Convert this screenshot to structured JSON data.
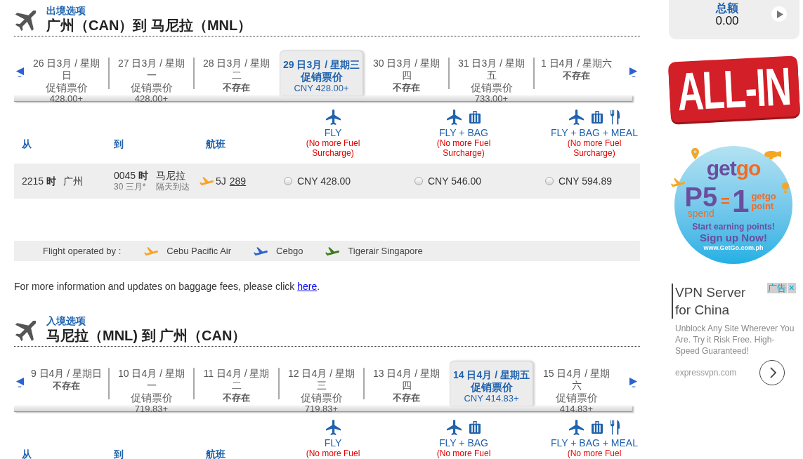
{
  "outbound": {
    "label": "出境选项",
    "route": "广州（CAN）到 马尼拉（MNL）",
    "dates": [
      {
        "date": "26 日3月 / 星期日",
        "kind": "fare",
        "fare": "促销票价",
        "price": "428.00+",
        "selected": false
      },
      {
        "date": "27 日3月 / 星期一",
        "kind": "fare",
        "fare": "促销票价",
        "price": "428.00+",
        "selected": false
      },
      {
        "date": "28 日3月 / 星期二",
        "kind": "unavailable",
        "fare": "不存在",
        "selected": false
      },
      {
        "date": "29 日3月 / 星期三",
        "kind": "fare",
        "fare": "促销票价",
        "price": "CNY 428.00+",
        "selected": true
      },
      {
        "date": "30 日3月 / 星期四",
        "kind": "unavailable",
        "fare": "不存在",
        "selected": false
      },
      {
        "date": "31 日3月 / 星期五",
        "kind": "fare",
        "fare": "促销票价",
        "price": "733.00+",
        "selected": false
      },
      {
        "date": "1 日4月 / 星期六",
        "kind": "unavailable",
        "fare": "不存在",
        "selected": false
      }
    ],
    "columns": [
      "从",
      "到",
      "航班"
    ],
    "fare_types": [
      {
        "kind": "fly",
        "name": "FLY",
        "note": "(No more Fuel Surcharge)"
      },
      {
        "kind": "fly_bag",
        "name": "FLY + BAG",
        "note": "(No more Fuel Surcharge)"
      },
      {
        "kind": "fly_bag_meal",
        "name": "FLY + BAG + MEAL",
        "note": "(No more Fuel Surcharge)"
      }
    ],
    "flights": [
      {
        "depart_time": "2215 **时**",
        "depart_city": "广州",
        "arrive_time": "0045 **时**",
        "arrive_city": "马尼拉",
        "arrive_date": "30 三月*",
        "arrive_note": "隔天到达",
        "color": "#f7a52a",
        "carrier": "5J",
        "flight_number": "289",
        "fares": [
          {
            "price": "CNY 428.00",
            "selected": false
          },
          {
            "price": "CNY 546.00",
            "selected": false
          },
          {
            "price": "CNY 594.89",
            "selected": false
          }
        ]
      }
    ]
  },
  "operators": {
    "label": "Flight operated by :",
    "items": [
      {
        "name": "Cebu Pacific Air",
        "color": "#f7a52a"
      },
      {
        "name": "Cebgo",
        "color": "#2f66cc"
      },
      {
        "name": "Tigerair Singapore",
        "color": "#3d7f17"
      }
    ]
  },
  "baggage_note": {
    "text": "For more information and updates on baggage fees, please click ",
    "link": "here",
    "end": "."
  },
  "inbound": {
    "label": "入境选项",
    "route": "马尼拉（MNL) 到 广州（CAN）",
    "dates": [
      {
        "date": "9 日4月 / 星期日",
        "kind": "unavailable",
        "fare": "不存在",
        "selected": false
      },
      {
        "date": "10 日4月 / 星期一",
        "kind": "fare",
        "fare": "促销票价",
        "price": "719.83+",
        "selected": false
      },
      {
        "date": "11 日4月 / 星期二",
        "kind": "unavailable",
        "fare": "不存在",
        "selected": false
      },
      {
        "date": "12 日4月 / 星期三",
        "kind": "fare",
        "fare": "促销票价",
        "price": "719.83+",
        "selected": false
      },
      {
        "date": "13 日4月 / 星期四",
        "kind": "unavailable",
        "fare": "不存在",
        "selected": false
      },
      {
        "date": "14 日4月 / 星期五",
        "kind": "fare",
        "fare": "促销票价",
        "price": "CNY 414.83+",
        "selected": true
      },
      {
        "date": "15 日4月 / 星期六",
        "kind": "fare",
        "fare": "促销票价",
        "price": "414.83+",
        "selected": false
      }
    ],
    "columns": [
      "从",
      "到",
      "航班"
    ],
    "fare_types": [
      {
        "kind": "fly",
        "name": "FLY",
        "note": "(No more Fuel"
      },
      {
        "kind": "fly_bag",
        "name": "FLY + BAG",
        "note": "(No more Fuel"
      },
      {
        "kind": "fly_bag_meal",
        "name": "FLY + BAG + MEAL",
        "note": "(No more Fuel"
      }
    ]
  },
  "total": {
    "label": "总额",
    "amount": "0.00"
  },
  "badge": "ALL-IN",
  "getgo_ad": {
    "logo": [
      {
        "text": "get",
        "color": "#6b4d9f"
      },
      {
        "text": "go",
        "color": "#f26b23"
      }
    ],
    "amount": "P5",
    "amount_caption": "spend",
    "equals": "=",
    "points": "1",
    "points_caption": "getgo point",
    "tagline": "Start earning points!",
    "cta": "Sign up Now!",
    "url": "www.GetGo.com.ph"
  },
  "vpn_ad": {
    "badge": "广告",
    "close": "×",
    "headline": "VPN Server for China",
    "description": "Unblock Any Site Wherever You Are. Try it Risk Free. High-Speed Guaranteed!",
    "url": "expressvpn.com"
  }
}
